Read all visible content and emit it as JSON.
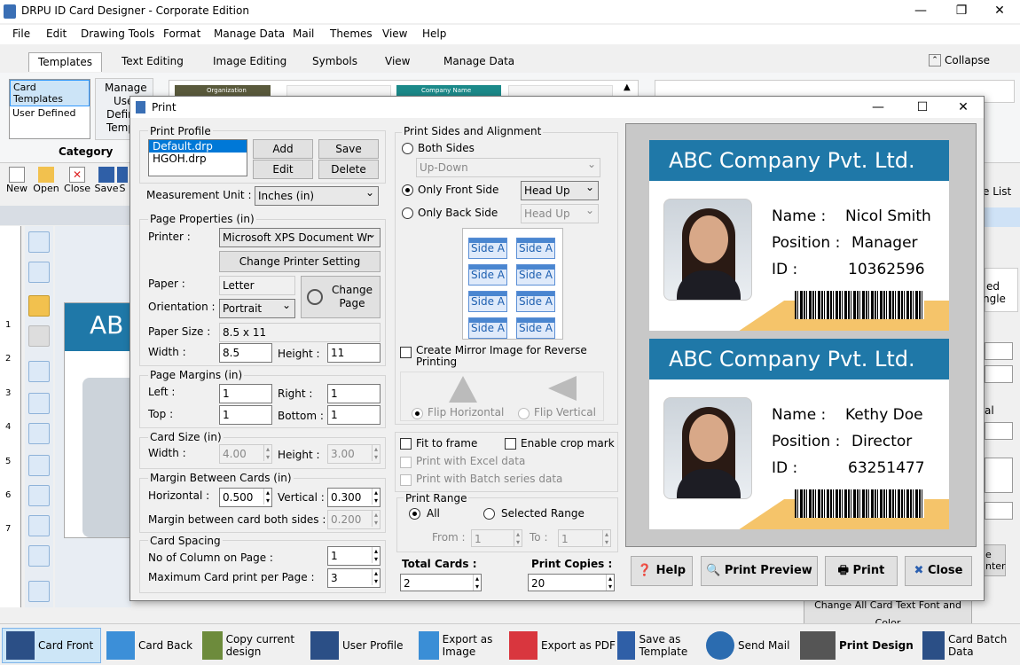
{
  "app": {
    "title": "DRPU ID Card Designer - Corporate Edition"
  },
  "menu": [
    "File",
    "Edit",
    "Drawing Tools",
    "Format",
    "Manage Data",
    "Mail",
    "Themes",
    "View",
    "Help"
  ],
  "ribbon_tabs": [
    "Templates",
    "Text Editing",
    "Image Editing",
    "Symbols",
    "View",
    "Manage Data"
  ],
  "collapse": "Collapse",
  "category": {
    "items": [
      "Card Templates",
      "User Defined"
    ],
    "label": "Category",
    "manage": [
      "Manage",
      "Use",
      "Defin",
      "Temp"
    ]
  },
  "thumbs": [
    "Organization",
    "Company Name"
  ],
  "toolbar": [
    "New",
    "Open",
    "Close",
    "Save",
    "S"
  ],
  "right_partial": {
    "list": "e List",
    "ed": "ed",
    "ngle": "ngle",
    "al": "al",
    "e": "e",
    "nter": "nter",
    "change_font": "Change All Card Text Font and Color"
  },
  "left_card_partial": "AB",
  "ruler": [
    "1",
    "2",
    "3",
    "4",
    "5",
    "6",
    "7"
  ],
  "dialog": {
    "title": "Print",
    "print_profile": {
      "label": "Print Profile",
      "items": [
        "Default.drp",
        "HGOH.drp"
      ],
      "add": "Add",
      "save": "Save",
      "edit": "Edit",
      "delete": "Delete"
    },
    "measurement": {
      "label": "Measurement Unit :",
      "value": "Inches (in)"
    },
    "page_props": {
      "label": "Page Properties (in)",
      "printer_label": "Printer :",
      "printer": "Microsoft XPS Document Wr",
      "change_printer": "Change Printer Setting",
      "paper_label": "Paper :",
      "paper": "Letter",
      "change_page": "Change Page",
      "orientation_label": "Orientation :",
      "orientation": "Portrait",
      "size_label": "Paper Size :",
      "size": "8.5 x 11",
      "width_label": "Width :",
      "width": "8.5",
      "height_label": "Height :",
      "height": "11"
    },
    "margins": {
      "label": "Page Margins (in)",
      "left_label": "Left :",
      "left": "1",
      "right_label": "Right :",
      "right": "1",
      "top_label": "Top :",
      "top": "1",
      "bottom_label": "Bottom :",
      "bottom": "1"
    },
    "card_size": {
      "label": "Card Size (in)",
      "width_label": "Width :",
      "width": "4.00",
      "height_label": "Height :",
      "height": "3.00"
    },
    "margin_between": {
      "label": "Margin Between Cards (in)",
      "h_label": "Horizontal :",
      "h": "0.500",
      "v_label": "Vertical :",
      "v": "0.300",
      "both_label": "Margin between card both sides :",
      "both": "0.200"
    },
    "spacing": {
      "label": "Card Spacing",
      "cols_label": "No of Column on Page :",
      "cols": "1",
      "max_label": "Maximum Card print per Page :",
      "max": "3"
    },
    "sides": {
      "label": "Print Sides and Alignment",
      "both": "Both Sides",
      "updown": "Up-Down",
      "front": "Only Front Side",
      "front_align": "Head Up",
      "back": "Only Back Side",
      "back_align": "Head Up",
      "side_a": "Side A",
      "mirror": "Create Mirror Image for Reverse Printing",
      "flip_h": "Flip Horizontal",
      "flip_v": "Flip Vertical"
    },
    "options": {
      "fit": "Fit to frame",
      "crop": "Enable crop mark",
      "excel": "Print with Excel data",
      "batch": "Print with Batch series data"
    },
    "range": {
      "label": "Print Range",
      "all": "All",
      "selected": "Selected Range",
      "from_label": "From :",
      "from": "1",
      "to_label": "To :",
      "to": "1"
    },
    "totals": {
      "cards_label": "Total Cards :",
      "cards": "2",
      "copies_label": "Print Copies :",
      "copies": "20"
    },
    "buttons": {
      "help": "Help",
      "preview": "Print Preview",
      "print": "Print",
      "close": "Close"
    },
    "cards": [
      {
        "company": "ABC Company Pvt. Ltd.",
        "name_label": "Name :",
        "name": "Nicol Smith",
        "pos_label": "Position :",
        "position": "Manager",
        "id_label": "ID :",
        "id": "10362596"
      },
      {
        "company": "ABC Company Pvt. Ltd.",
        "name_label": "Name :",
        "name": "Kethy Doe",
        "pos_label": "Position :",
        "position": "Director",
        "id_label": "ID :",
        "id": "63251477"
      }
    ]
  },
  "bottom": [
    "Card Front",
    "Card Back",
    "Copy current design",
    "User Profile",
    "Export as Image",
    "Export as PDF",
    "Save as Template",
    "Send Mail",
    "Print Design",
    "Card Batch Data"
  ]
}
